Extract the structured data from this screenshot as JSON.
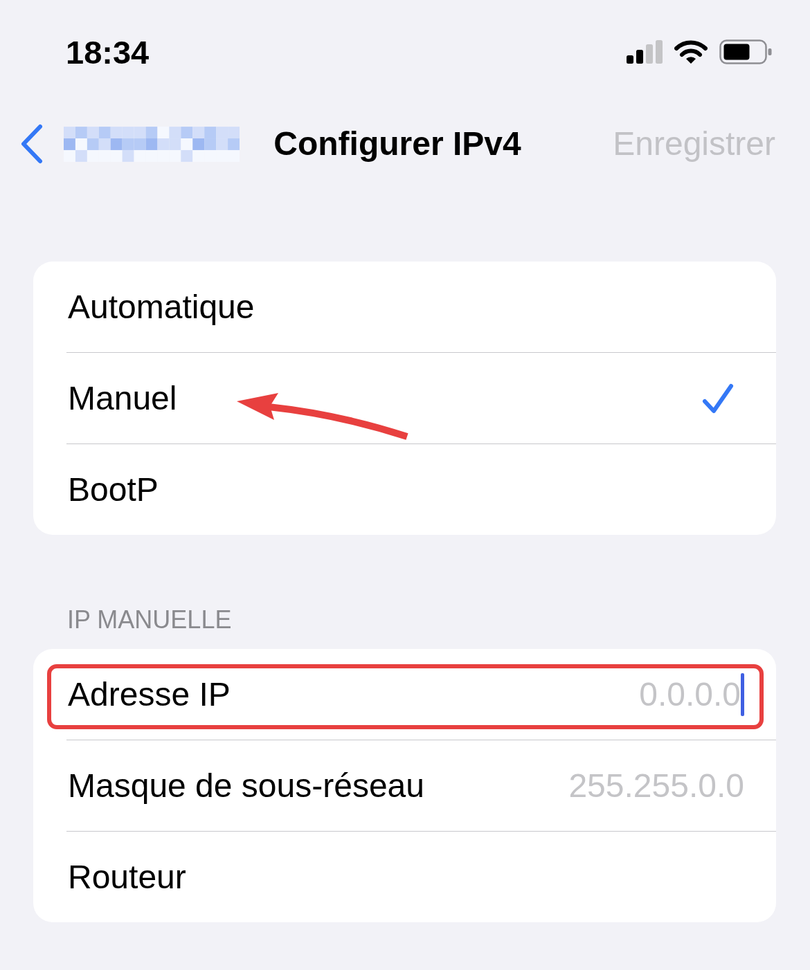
{
  "status_bar": {
    "time": "18:34"
  },
  "nav_bar": {
    "title": "Configurer IPv4",
    "action": {
      "label": "Enregistrer",
      "disabled": true
    }
  },
  "options": [
    {
      "label": "Automatique",
      "selected": false,
      "annotated": false
    },
    {
      "label": "Manuel",
      "selected": true,
      "annotated": true
    },
    {
      "label": "BootP",
      "selected": false,
      "annotated": false
    }
  ],
  "manual_section": {
    "header": "IP MANUELLE",
    "fields": [
      {
        "label": "Adresse IP",
        "placeholder": "0.0.0.0",
        "focused": true,
        "highlighted": true
      },
      {
        "label": "Masque de sous-réseau",
        "placeholder": "255.255.0.0",
        "focused": false,
        "highlighted": false
      },
      {
        "label": "Routeur",
        "focused": false,
        "highlighted": false
      }
    ]
  }
}
